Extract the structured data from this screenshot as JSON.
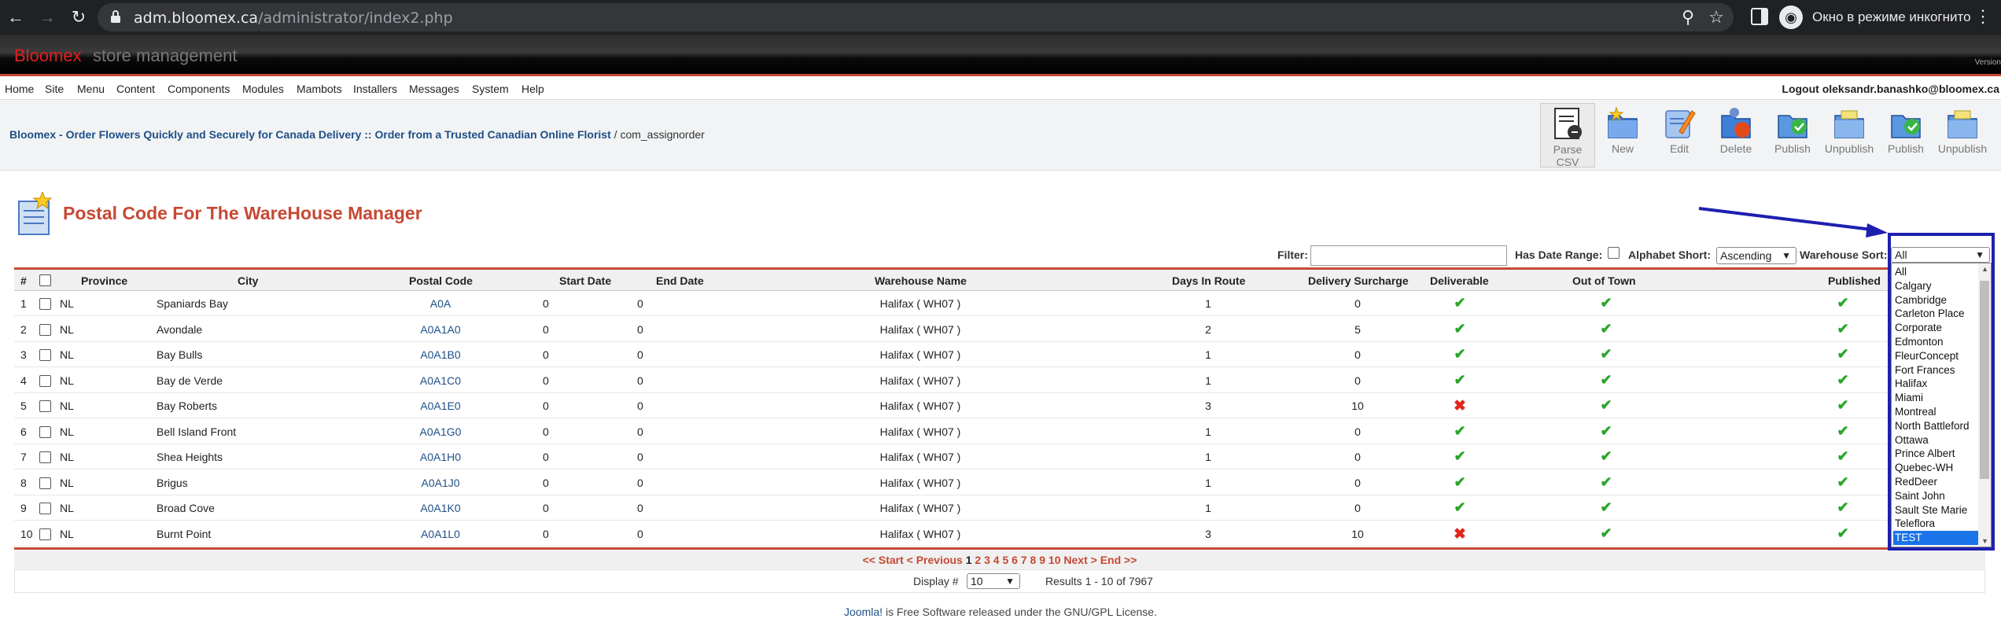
{
  "browser": {
    "url_host": "adm.bloomex.ca",
    "url_path": "/administrator/index2.php",
    "incognito_label": "Окно в режиме инкогнито"
  },
  "header": {
    "brand": "Bloomex",
    "subtitle": "store management",
    "version": "Version"
  },
  "menu": {
    "items": [
      "Home",
      "Site",
      "Menu",
      "Content",
      "Components",
      "Modules",
      "Mambots",
      "Installers",
      "Messages",
      "System",
      "Help"
    ],
    "logout": "Logout oleksandr.banashko@bloomex.ca"
  },
  "breadcrumb": {
    "site": "Bloomex - Order Flowers Quickly and Securely for Canada Delivery :: Order from a Trusted Canadian Online Florist",
    "separator": " / ",
    "component": "com_assignorder"
  },
  "toolbar": {
    "parse_label": "Parse CSV",
    "buttons": [
      "New",
      "Edit",
      "Delete",
      "Publish",
      "Unpublish",
      "Publish",
      "Unpublish"
    ]
  },
  "page_title": "Postal Code For The WareHouse Manager",
  "filters": {
    "filter_label": "Filter:",
    "filter_value": "",
    "has_date_range_label": "Has Date Range:",
    "alphabet_label": "Alphabet Short:",
    "alphabet_value": "Ascending",
    "warehouse_label": "Warehouse Sort:",
    "warehouse_value": "All"
  },
  "table": {
    "headers": [
      "#",
      "Province",
      "City",
      "Postal Code",
      "Start Date",
      "End Date",
      "Warehouse Name",
      "Days In Route",
      "Delivery Surcharge",
      "Deliverable",
      "Out of Town",
      "Published"
    ],
    "rows": [
      {
        "num": "1",
        "province": "NL",
        "city": "Spaniards Bay",
        "postal": "A0A",
        "start": "0",
        "end": "0",
        "warehouse": "Halifax ( WH07 )",
        "days": "1",
        "surcharge": "0",
        "deliverable": true,
        "out_of_town": true,
        "published": true
      },
      {
        "num": "2",
        "province": "NL",
        "city": "Avondale",
        "postal": "A0A1A0",
        "start": "0",
        "end": "0",
        "warehouse": "Halifax ( WH07 )",
        "days": "2",
        "surcharge": "5",
        "deliverable": true,
        "out_of_town": true,
        "published": true
      },
      {
        "num": "3",
        "province": "NL",
        "city": "Bay Bulls",
        "postal": "A0A1B0",
        "start": "0",
        "end": "0",
        "warehouse": "Halifax ( WH07 )",
        "days": "1",
        "surcharge": "0",
        "deliverable": true,
        "out_of_town": true,
        "published": true
      },
      {
        "num": "4",
        "province": "NL",
        "city": "Bay de Verde",
        "postal": "A0A1C0",
        "start": "0",
        "end": "0",
        "warehouse": "Halifax ( WH07 )",
        "days": "1",
        "surcharge": "0",
        "deliverable": true,
        "out_of_town": true,
        "published": true
      },
      {
        "num": "5",
        "province": "NL",
        "city": "Bay Roberts",
        "postal": "A0A1E0",
        "start": "0",
        "end": "0",
        "warehouse": "Halifax ( WH07 )",
        "days": "3",
        "surcharge": "10",
        "deliverable": false,
        "out_of_town": true,
        "published": true
      },
      {
        "num": "6",
        "province": "NL",
        "city": "Bell Island Front",
        "postal": "A0A1G0",
        "start": "0",
        "end": "0",
        "warehouse": "Halifax ( WH07 )",
        "days": "1",
        "surcharge": "0",
        "deliverable": true,
        "out_of_town": true,
        "published": true
      },
      {
        "num": "7",
        "province": "NL",
        "city": "Shea Heights",
        "postal": "A0A1H0",
        "start": "0",
        "end": "0",
        "warehouse": "Halifax ( WH07 )",
        "days": "1",
        "surcharge": "0",
        "deliverable": true,
        "out_of_town": true,
        "published": true
      },
      {
        "num": "8",
        "province": "NL",
        "city": "Brigus",
        "postal": "A0A1J0",
        "start": "0",
        "end": "0",
        "warehouse": "Halifax ( WH07 )",
        "days": "1",
        "surcharge": "0",
        "deliverable": true,
        "out_of_town": true,
        "published": true
      },
      {
        "num": "9",
        "province": "NL",
        "city": "Broad Cove",
        "postal": "A0A1K0",
        "start": "0",
        "end": "0",
        "warehouse": "Halifax ( WH07 )",
        "days": "1",
        "surcharge": "0",
        "deliverable": true,
        "out_of_town": true,
        "published": true
      },
      {
        "num": "10",
        "province": "NL",
        "city": "Burnt Point",
        "postal": "A0A1L0",
        "start": "0",
        "end": "0",
        "warehouse": "Halifax ( WH07 )",
        "days": "3",
        "surcharge": "10",
        "deliverable": false,
        "out_of_town": true,
        "published": true
      }
    ]
  },
  "pagination": {
    "start": "<< Start",
    "previous": "< Previous",
    "current": "1",
    "pages": [
      "2",
      "3",
      "4",
      "5",
      "6",
      "7",
      "8",
      "9",
      "10"
    ],
    "next": "Next >",
    "end": "End >>",
    "display_label": "Display #",
    "display_value": "10",
    "results": "Results 1 - 10 of 7967"
  },
  "footer": {
    "link": "Joomla!",
    "text": " is Free Software released under the GNU/GPL License."
  },
  "warehouse_dropdown": {
    "options": [
      "All",
      "Calgary",
      "Cambridge",
      "Carleton Place",
      "Corporate",
      "Edmonton",
      "FleurConcept",
      "Fort Frances",
      "Halifax",
      "Miami",
      "Montreal",
      "North Battleford",
      "Ottawa",
      "Prince Albert",
      "Quebec-WH",
      "RedDeer",
      "Saint John",
      "Sault Ste Marie",
      "Teleflora",
      "TEST"
    ],
    "highlighted": "TEST"
  },
  "colors": {
    "accent_red": "#c64934",
    "link_blue": "#1f4f87",
    "check_green": "#2aa52a",
    "cross_red": "#e0261a",
    "highlight_blue": "#1e1fb0"
  }
}
